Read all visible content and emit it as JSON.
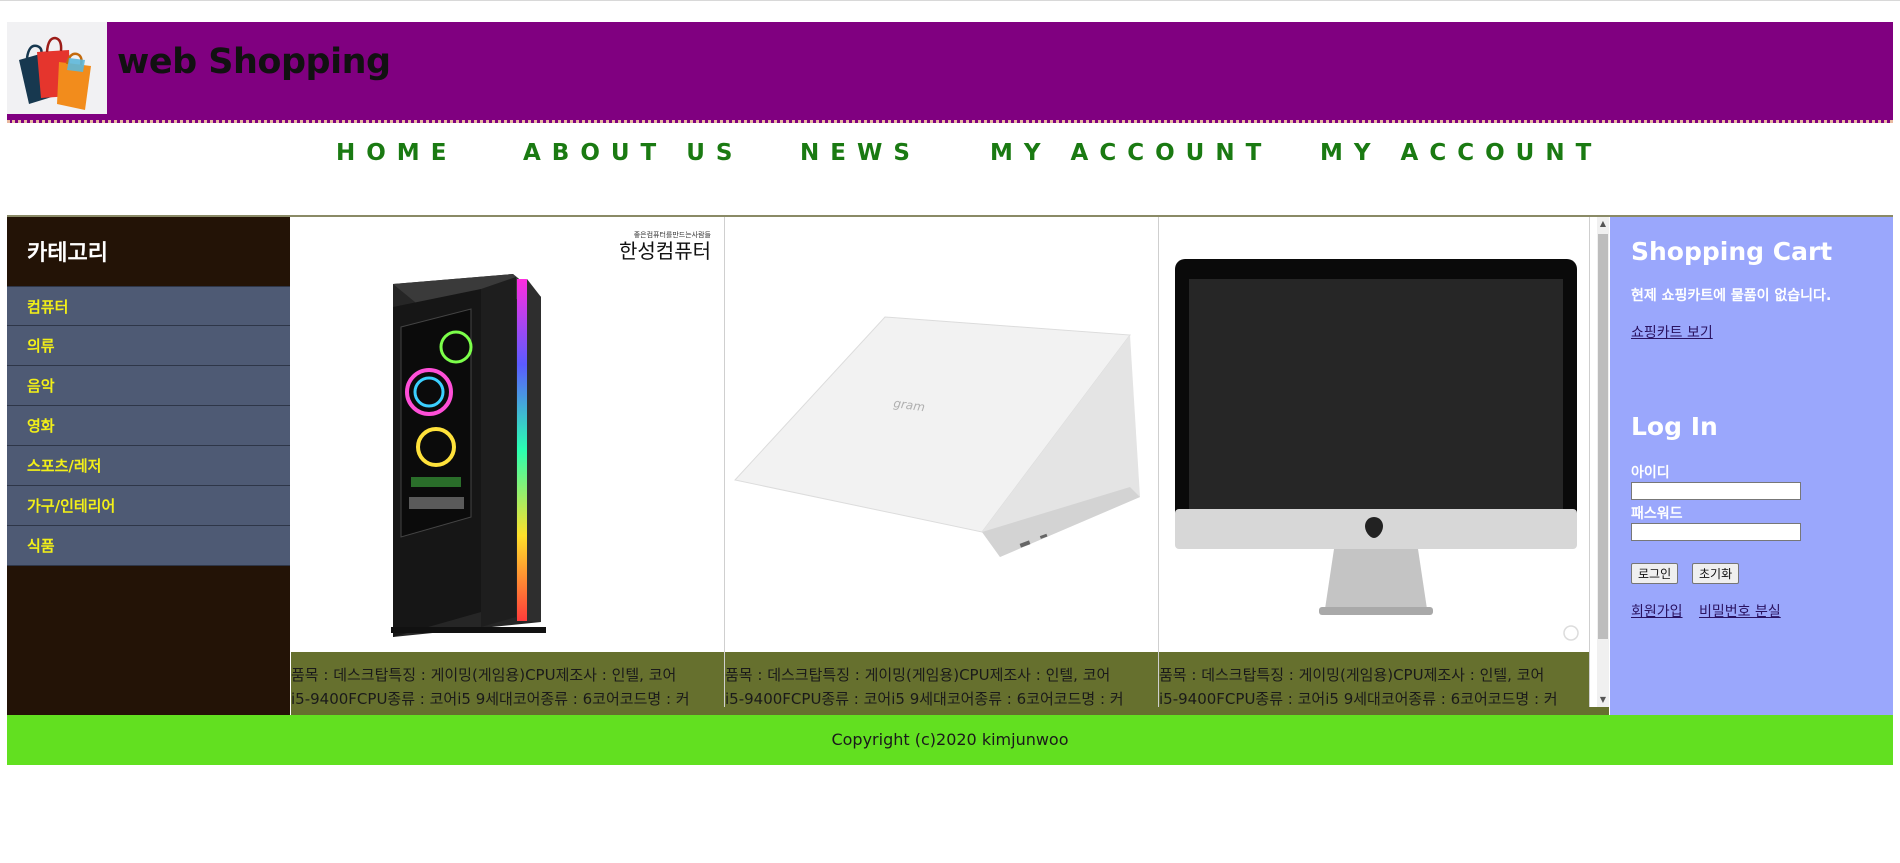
{
  "header": {
    "title": "web Shopping",
    "logo_icon": "shopping-bags-icon",
    "background": "#800080"
  },
  "nav": {
    "items": [
      {
        "label": "HOME"
      },
      {
        "label": "ABOUT US"
      },
      {
        "label": "NEWS"
      },
      {
        "label": "MY ACCOUNT"
      },
      {
        "label": "MY ACCOUNT"
      }
    ],
    "color": "#1a7a12"
  },
  "sidebar": {
    "title": "카테고리",
    "items": [
      {
        "label": "컴퓨터"
      },
      {
        "label": "의류"
      },
      {
        "label": "음악"
      },
      {
        "label": "영화"
      },
      {
        "label": "스포츠/레저"
      },
      {
        "label": "가구/인테리어"
      },
      {
        "label": "식품"
      }
    ]
  },
  "products": [
    {
      "image": "desktop-pc-case-image",
      "brand_text": "한성컴퓨터",
      "brand_subtext": "좋은컴퓨터를만드는사람들",
      "desc_line1": "품목 : 데스크탑특징 : 게이밍(게임용)CPU제조사 : 인텔, 코어",
      "desc_line2": "i5-9400FCPU종류 : 코어i5 9세대코어종류 : 6코어코드명 : 커"
    },
    {
      "image": "white-laptop-image",
      "brand_text": "gram",
      "desc_line1": "품목 : 데스크탑특징 : 게이밍(게임용)CPU제조사 : 인텔, 코어",
      "desc_line2": "i5-9400FCPU종류 : 코어i5 9세대코어종류 : 6코어코드명 : 커"
    },
    {
      "image": "imac-image",
      "desc_line1": "품목 : 데스크탑특징 : 게이밍(게임용)CPU제조사 : 인텔, 코어",
      "desc_line2": "i5-9400FCPU종류 : 코어i5 9세대코어종류 : 6코어코드명 : 커"
    }
  ],
  "cart": {
    "title": "Shopping Cart",
    "empty_text": "현제 쇼핑카트에 물품이 없습니다.",
    "view_link": "쇼핑카트 보기"
  },
  "login": {
    "title": "Log In",
    "id_label": "아이디",
    "pw_label": "패스워드",
    "login_button": "로그인",
    "reset_button": "초기화",
    "signup_link": "회원가입",
    "find_pw_link": "비밀번호 분실"
  },
  "footer": {
    "copyright": "Copyright (c)2020 kimjunwoo"
  }
}
